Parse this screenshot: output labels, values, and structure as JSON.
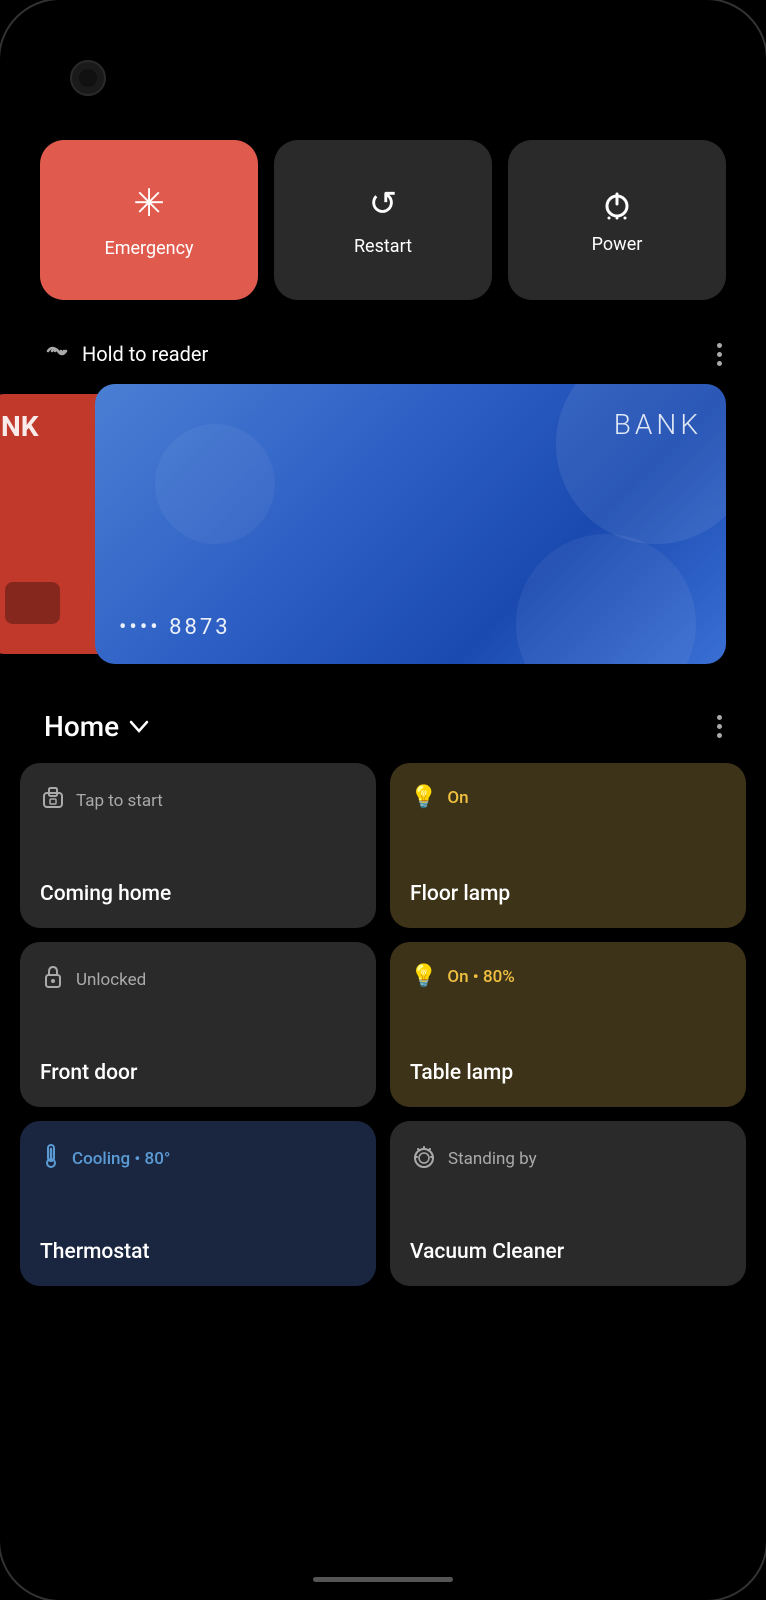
{
  "phone": {
    "bg": "#000"
  },
  "quick_actions": {
    "emergency": {
      "label": "Emergency",
      "icon": "✳",
      "bg": "#E05A4E"
    },
    "restart": {
      "label": "Restart",
      "icon": "↺",
      "bg": "#2a2a2a"
    },
    "power": {
      "label": "Power",
      "icon": "⏻",
      "bg": "#2a2a2a"
    }
  },
  "nfc": {
    "title": "Hold to reader",
    "waves": "◌◌",
    "card": {
      "bank_name": "BANK",
      "number_masked": "•••• 8873"
    }
  },
  "home": {
    "title": "Home",
    "tiles": [
      {
        "status": "Tap to start",
        "name": "Coming home",
        "icon": "🔓",
        "icon_label": "routine-icon",
        "type": "dark"
      },
      {
        "status": "On",
        "name": "Floor lamp",
        "icon": "💡",
        "icon_label": "lamp-icon",
        "type": "warm"
      },
      {
        "status": "Unlocked",
        "name": "Front door",
        "icon": "🔓",
        "icon_label": "door-icon",
        "type": "dark"
      },
      {
        "status": "On • 80%",
        "name": "Table lamp",
        "icon": "💡",
        "icon_label": "table-lamp-icon",
        "type": "warm"
      },
      {
        "status": "Cooling • 80°",
        "name": "Thermostat",
        "icon": "🌡",
        "icon_label": "thermostat-icon",
        "type": "blue"
      },
      {
        "status": "Standing by",
        "name": "Vacuum Cleaner",
        "icon": "🤖",
        "icon_label": "vacuum-icon",
        "type": "dark"
      }
    ]
  }
}
